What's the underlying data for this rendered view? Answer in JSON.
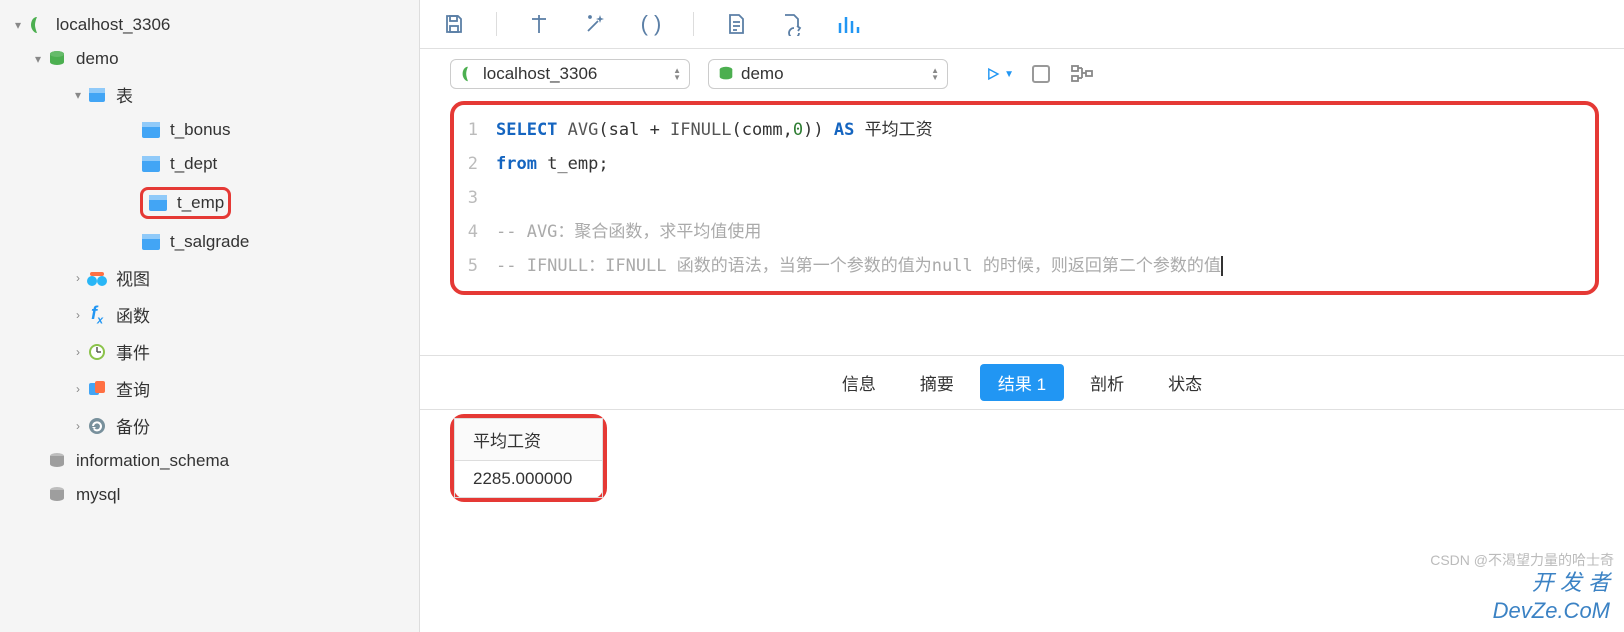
{
  "sidebar": {
    "connection": "localhost_3306",
    "database": "demo",
    "tables_label": "表",
    "tables": [
      "t_bonus",
      "t_dept",
      "t_emp",
      "t_salgrade"
    ],
    "highlighted_table_index": 2,
    "views_label": "视图",
    "functions_label": "函数",
    "events_label": "事件",
    "queries_label": "查询",
    "backup_label": "备份",
    "other_dbs": [
      "information_schema",
      "mysql"
    ]
  },
  "connection_bar": {
    "connection": "localhost_3306",
    "database": "demo"
  },
  "editor": {
    "lines": [
      {
        "num": "1",
        "tokens": [
          {
            "t": "SELECT",
            "c": "kw"
          },
          {
            "t": " "
          },
          {
            "t": "AVG",
            "c": "fn"
          },
          {
            "t": "(sal + "
          },
          {
            "t": "IFNULL",
            "c": "fn"
          },
          {
            "t": "(comm,"
          },
          {
            "t": "0",
            "c": "num"
          },
          {
            "t": ")) "
          },
          {
            "t": "AS",
            "c": "as"
          },
          {
            "t": " 平均工资"
          }
        ]
      },
      {
        "num": "2",
        "tokens": [
          {
            "t": "from",
            "c": "kw"
          },
          {
            "t": " t_emp;"
          }
        ]
      },
      {
        "num": "3",
        "tokens": []
      },
      {
        "num": "4",
        "tokens": [
          {
            "t": "-- AVG：聚合函数，求平均值使用",
            "c": "comment"
          }
        ]
      },
      {
        "num": "5",
        "tokens": [
          {
            "t": "-- IFNULL：IFNULL 函数的语法，当第一个参数的值为null 的时候，则返回第二个参数的值",
            "c": "comment"
          }
        ],
        "cursor": true
      }
    ]
  },
  "result_tabs": {
    "items": [
      "信息",
      "摘要",
      "结果 1",
      "剖析",
      "状态"
    ],
    "active_index": 2
  },
  "result": {
    "columns": [
      "平均工资"
    ],
    "rows": [
      [
        "2285.000000"
      ]
    ]
  },
  "watermark": {
    "line1": "CSDN @不渴望力量的哈士奇",
    "line2": "开 发 者",
    "line3": "DevZe.CoM"
  }
}
